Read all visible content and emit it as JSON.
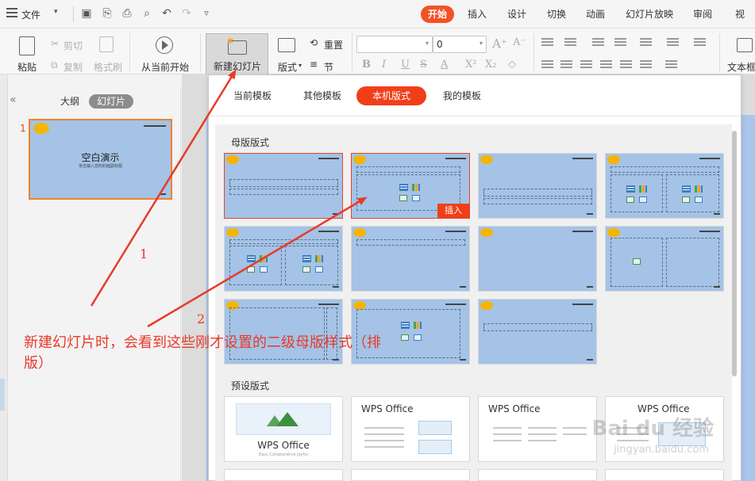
{
  "topbar": {
    "file_label": "文件",
    "tabs": [
      "开始",
      "插入",
      "设计",
      "切换",
      "动画",
      "幻灯片放映",
      "审阅",
      "视"
    ],
    "active_tab": "开始"
  },
  "ribbon": {
    "paste": "粘贴",
    "cut": "剪切",
    "copy": "复制",
    "format_painter": "格式刷",
    "play_from_current": "从当前开始",
    "new_slide": "新建幻灯片",
    "layout": "版式",
    "reset": "重置",
    "section": "节",
    "font_size_value": "0",
    "text_box": "文本框"
  },
  "left_panel": {
    "tab_outline": "大纲",
    "tab_slides": "幻灯片",
    "slide_number": "1",
    "thumb_title": "空白演示",
    "thumb_subtitle": "单击输入您的封面副标题"
  },
  "dropdown": {
    "tabs": [
      "当前模板",
      "其他模板",
      "本机版式",
      "我的模板"
    ],
    "active_tab": "本机版式",
    "master_section_title": "母版版式",
    "preset_section_title": "预设版式",
    "insert_label": "插入",
    "preset_titles": [
      "WPS Office",
      "WPS Office",
      "WPS Office",
      "WPS Office"
    ],
    "preset_subtitle": "Easy Collaborative Joyful"
  },
  "annotations": {
    "number_1": "1",
    "number_2": "2",
    "text": "新建幻灯片时，会看到这些刚才设置的二级母版样式（排版）",
    "color": "#e83a2a"
  },
  "watermark": {
    "brand": "Bai du 经验",
    "url": "jingyan.baidu.com"
  },
  "colors": {
    "accent": "#f25325",
    "slide_blue": "#a4c3e6",
    "selection": "#e8432a"
  }
}
